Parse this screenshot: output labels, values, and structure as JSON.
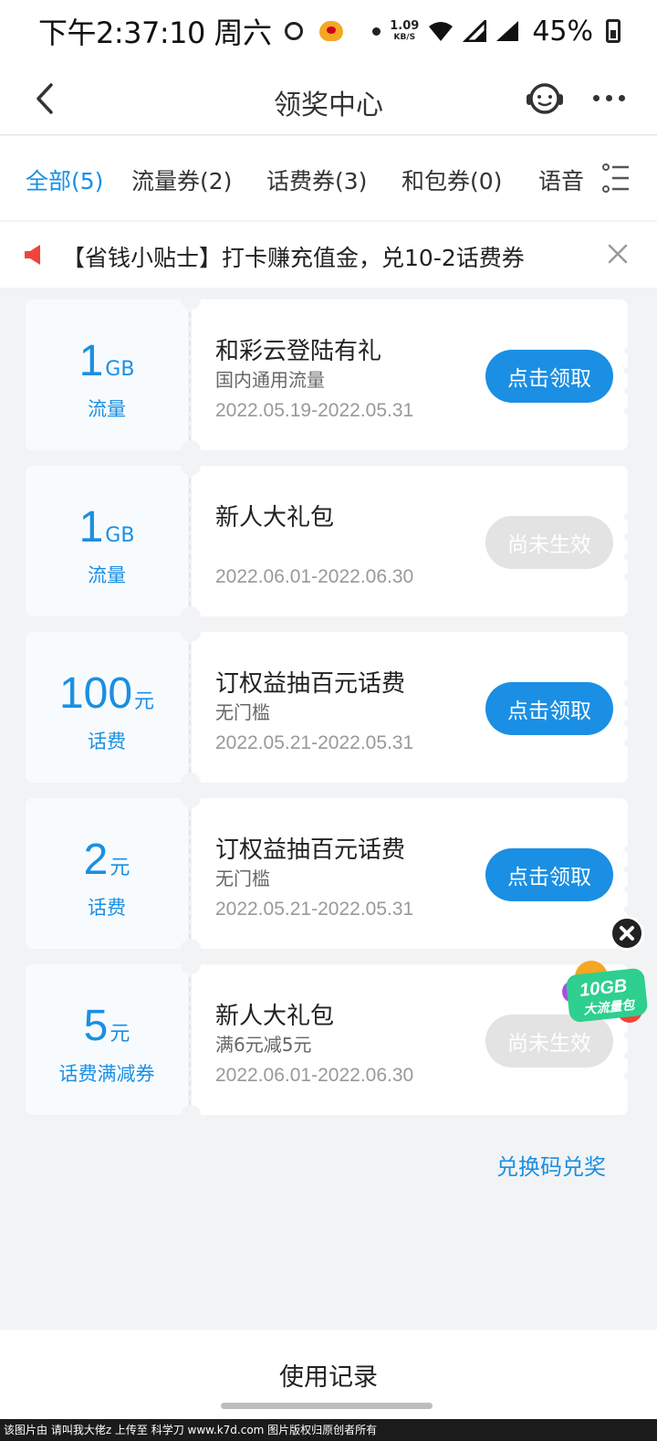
{
  "status_bar": {
    "time": "下午2:37:10 周六",
    "net_speed_value": "1.09",
    "net_speed_unit": "KB/S",
    "battery": "45%"
  },
  "header": {
    "title": "领奖中心"
  },
  "tabs": [
    {
      "label": "全部(5)",
      "active": true
    },
    {
      "label": "流量券(2)",
      "active": false
    },
    {
      "label": "话费券(3)",
      "active": false
    },
    {
      "label": "和包券(0)",
      "active": false
    },
    {
      "label": "语音",
      "active": false
    }
  ],
  "tip": {
    "text": "【省钱小贴士】打卡赚充值金，兑10-2话费券"
  },
  "coupons": [
    {
      "amount": "1",
      "unit": "GB",
      "type": "流量",
      "title": "和彩云登陆有礼",
      "subtitle": "国内通用流量",
      "date": "2022.05.19-2022.05.31",
      "button": "点击领取",
      "state": "active"
    },
    {
      "amount": "1",
      "unit": "GB",
      "type": "流量",
      "title": "新人大礼包",
      "subtitle": "",
      "date": "2022.06.01-2022.06.30",
      "button": "尚未生效",
      "state": "disabled"
    },
    {
      "amount": "100",
      "unit": "元",
      "type": "话费",
      "title": "订权益抽百元话费",
      "subtitle": "无门槛",
      "date": "2022.05.21-2022.05.31",
      "button": "点击领取",
      "state": "active"
    },
    {
      "amount": "2",
      "unit": "元",
      "type": "话费",
      "title": "订权益抽百元话费",
      "subtitle": "无门槛",
      "date": "2022.05.21-2022.05.31",
      "button": "点击领取",
      "state": "active"
    },
    {
      "amount": "5",
      "unit": "元",
      "type": "话费满减券",
      "title": "新人大礼包",
      "subtitle": "满6元减5元",
      "date": "2022.06.01-2022.06.30",
      "button": "尚未生效",
      "state": "disabled"
    }
  ],
  "redeem_link": "兑换码兑奖",
  "floating_badge": {
    "line1": "10GB",
    "line2": "大流量包"
  },
  "bottom": {
    "history_label": "使用记录"
  },
  "watermark": "该图片由 请叫我大佬z 上传至 科学刀 www.k7d.com 图片版权归原创者所有",
  "colors": {
    "accent": "#1a8fe3",
    "disabled_button": "#e3e3e3",
    "background": "#f2f3f5",
    "tip_speaker": "#f0443b"
  },
  "icons": {
    "back": "chevron-left-icon",
    "service": "headset-icon",
    "more": "more-dots-icon",
    "filter": "list-filter-icon",
    "speaker": "speaker-icon",
    "close": "close-icon"
  }
}
